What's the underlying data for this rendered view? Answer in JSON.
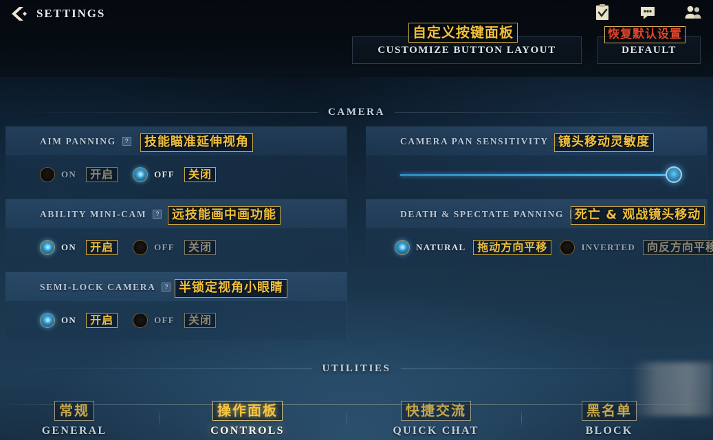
{
  "header": {
    "title": "SETTINGS",
    "back_icon": "back-arrow-icon",
    "customize_button": {
      "en": "CUSTOMIZE BUTTON LAYOUT",
      "cn": "自定义按键面板"
    },
    "default_button": {
      "en": "DEFAULT",
      "cn": "恢复默认设置"
    },
    "icons": [
      {
        "name": "clipboard-check-icon"
      },
      {
        "name": "chat-bubble-icon"
      },
      {
        "name": "friends-icon"
      }
    ]
  },
  "sections": {
    "camera": "CAMERA",
    "utilities": "UTILITIES"
  },
  "settings": {
    "left": [
      {
        "label": "AIM PANNING",
        "cn": "技能瞄准延伸视角",
        "help": "?",
        "options": [
          {
            "en": "ON",
            "cn": "开启",
            "selected": false
          },
          {
            "en": "OFF",
            "cn": "关闭",
            "selected": true
          }
        ]
      },
      {
        "label": "ABILITY MINI-CAM",
        "cn": "远技能画中画功能",
        "help": "?",
        "options": [
          {
            "en": "ON",
            "cn": "开启",
            "selected": true
          },
          {
            "en": "OFF",
            "cn": "关闭",
            "selected": false
          }
        ]
      },
      {
        "label": "SEMI-LOCK CAMERA",
        "cn": "半锁定视角小眼睛",
        "help": "?",
        "options": [
          {
            "en": "ON",
            "cn": "开启",
            "selected": true
          },
          {
            "en": "OFF",
            "cn": "关闭",
            "selected": false
          }
        ]
      }
    ],
    "right": [
      {
        "label": "CAMERA PAN SENSITIVITY",
        "cn": "镜头移动灵敏度",
        "help": "?",
        "control": "slider",
        "value": 100
      },
      {
        "label": "DEATH & SPECTATE PANNING",
        "cn": "死亡 & 观战镜头移动",
        "help": "?",
        "options": [
          {
            "en": "NATURAL",
            "cn": "拖动方向平移",
            "selected": true
          },
          {
            "en": "INVERTED",
            "cn": "向反方向平移",
            "selected": false
          }
        ]
      }
    ]
  },
  "tabs": [
    {
      "en": "GENERAL",
      "cn": "常规",
      "active": false
    },
    {
      "en": "CONTROLS",
      "cn": "操作面板",
      "active": true
    },
    {
      "en": "QUICK CHAT",
      "cn": "快捷交流",
      "active": false
    },
    {
      "en": "BLOCK",
      "cn": "黑名单",
      "active": false
    }
  ],
  "colors": {
    "gold": "#f0bf3c",
    "blue_accent": "#3fa4dd",
    "red": "#e0452a"
  }
}
